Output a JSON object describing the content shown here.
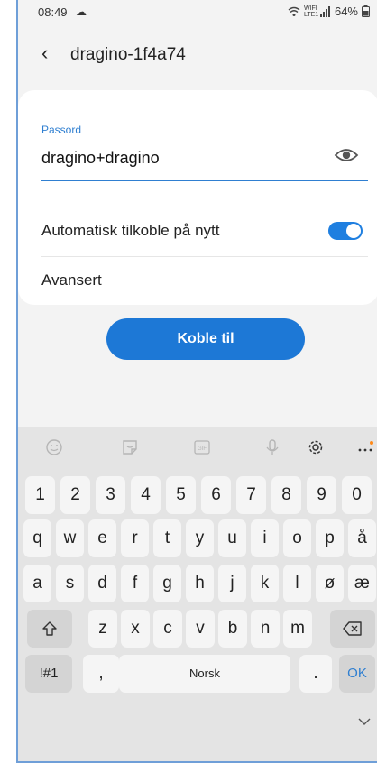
{
  "status_bar": {
    "time": "08:49",
    "wifi_label": "WIFI",
    "lte_label": "LTE1",
    "battery": "64%"
  },
  "header": {
    "title": "dragino-1f4a74"
  },
  "password": {
    "label": "Passord",
    "value": "dragino+dragino"
  },
  "auto_reconnect": {
    "label": "Automatisk tilkoble på nytt",
    "enabled": true
  },
  "advanced": {
    "label": "Avansert"
  },
  "connect_button": {
    "label": "Koble til"
  },
  "keyboard": {
    "numbers": [
      "1",
      "2",
      "3",
      "4",
      "5",
      "6",
      "7",
      "8",
      "9",
      "0"
    ],
    "row1": [
      "q",
      "w",
      "e",
      "r",
      "t",
      "y",
      "u",
      "i",
      "o",
      "p",
      "å"
    ],
    "row2": [
      "a",
      "s",
      "d",
      "f",
      "g",
      "h",
      "j",
      "k",
      "l",
      "ø",
      "æ"
    ],
    "row3": [
      "z",
      "x",
      "c",
      "v",
      "b",
      "n",
      "m"
    ],
    "symbols_key": "!#1",
    "comma_key": ",",
    "space_key": "Norsk",
    "period_key": ".",
    "ok_key": "OK",
    "gif_label": "GIF"
  },
  "colors": {
    "accent": "#1d78d6",
    "keyboard_bg": "#e4e4e4"
  }
}
